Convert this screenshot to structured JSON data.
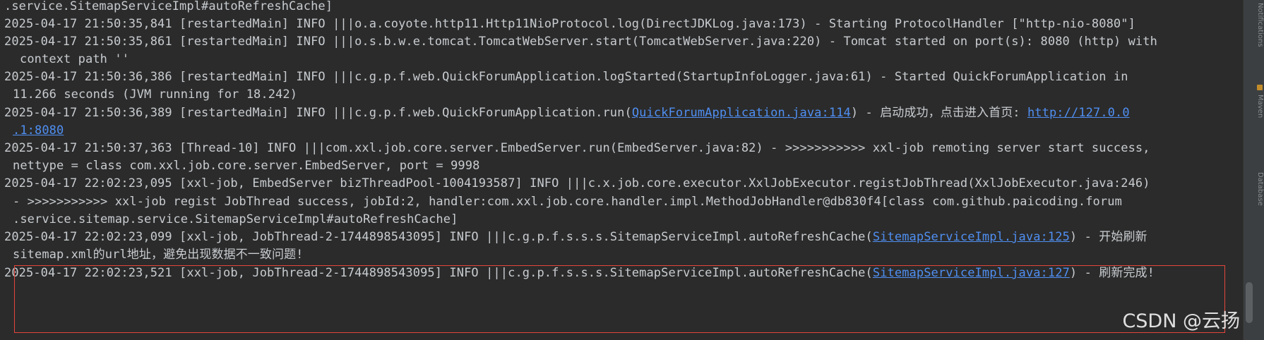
{
  "console": {
    "lines": [
      {
        "text": ".service.SitemapServiceImpl#autoRefreshCache]"
      },
      {
        "text": "2025-04-17 21:50:35,841 [restartedMain] INFO |||o.a.coyote.http11.Http11NioProtocol.log(DirectJDKLog.java:173) - Starting ProtocolHandler [\"http-nio-8080\"]"
      },
      {
        "text": "2025-04-17 21:50:35,861 [restartedMain] INFO |||o.s.b.w.e.tomcat.TomcatWebServer.start(TomcatWebServer.java:220) - Tomcat started on port(s): 8080 (http) with"
      },
      {
        "text": "context path ''"
      },
      {
        "text": "2025-04-17 21:50:36,386 [restartedMain] INFO |||c.g.p.f.web.QuickForumApplication.logStarted(StartupInfoLogger.java:61) - Started QuickForumApplication in"
      },
      {
        "text": "11.266 seconds (JVM running for 18.242)"
      },
      {
        "prefix": "2025-04-17 21:50:36,389 [restartedMain] INFO |||c.g.p.f.web.QuickForumApplication.run(",
        "link": "QuickForumApplication.java:114",
        "middle": ") - 启动成功，点击进入首页: ",
        "link2": "http://127.0.0"
      },
      {
        "link": ".1:8080"
      },
      {
        "text": "2025-04-17 21:50:37,363 [Thread-10] INFO |||com.xxl.job.core.server.EmbedServer.run(EmbedServer.java:82) - >>>>>>>>>>> xxl-job remoting server start success,"
      },
      {
        "text": "nettype = class com.xxl.job.core.server.EmbedServer, port = 9998"
      },
      {
        "text": "2025-04-17 22:02:23,095 [xxl-job, EmbedServer bizThreadPool-1004193587] INFO |||c.x.job.core.executor.XxlJobExecutor.registJobThread(XxlJobExecutor.java:246)"
      },
      {
        "text": "- >>>>>>>>>>> xxl-job regist JobThread success, jobId:2, handler:com.xxl.job.core.handler.impl.MethodJobHandler@db830f4[class com.github.paicoding.forum"
      },
      {
        "text": ".service.sitemap.service.SitemapServiceImpl#autoRefreshCache]"
      },
      {
        "prefix": "2025-04-17 22:02:23,099 [xxl-job, JobThread-2-1744898543095] INFO |||c.g.p.f.s.s.s.SitemapServiceImpl.autoRefreshCache(",
        "link": "SitemapServiceImpl.java:125",
        "suffix": ") - 开始刷新"
      },
      {
        "text": "sitemap.xml的url地址，避免出现数据不一致问题!"
      },
      {
        "prefix": "2025-04-17 22:02:23,521 [xxl-job, JobThread-2-1744898543095] INFO |||c.g.p.f.s.s.s.SitemapServiceImpl.autoRefreshCache(",
        "link": "SitemapServiceImpl.java:127",
        "suffix": ") - 刷新完成!"
      }
    ]
  },
  "side_tabs": [
    "Notifications",
    "Maven",
    "Database"
  ],
  "watermark": "CSDN @云扬"
}
